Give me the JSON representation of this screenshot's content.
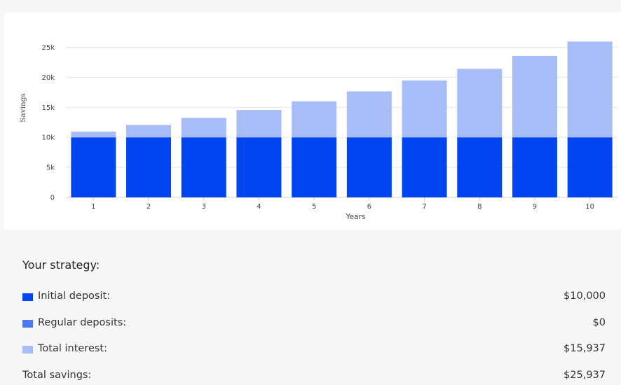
{
  "chart_data": {
    "type": "bar",
    "stacked": true,
    "categories": [
      "1",
      "2",
      "3",
      "4",
      "5",
      "6",
      "7",
      "8",
      "9",
      "10"
    ],
    "series": [
      {
        "name": "Initial deposit",
        "color": "#0045ef",
        "values": [
          10000,
          10000,
          10000,
          10000,
          10000,
          10000,
          10000,
          10000,
          10000,
          10000
        ]
      },
      {
        "name": "Total interest",
        "color": "#a8bcf8",
        "values": [
          950,
          2050,
          3250,
          4550,
          6000,
          7650,
          9450,
          11400,
          13550,
          15937
        ]
      }
    ],
    "xlabel": "Years",
    "ylabel": "Savings",
    "yticks": [
      0,
      5000,
      10000,
      15000,
      20000,
      25000
    ],
    "ytick_labels": [
      "0",
      "5k",
      "10k",
      "15k",
      "20k",
      "25k"
    ],
    "ylim": [
      0,
      27500
    ],
    "grid": true
  },
  "strategy": {
    "title": "Your strategy:",
    "rows": [
      {
        "label": "Initial deposit:",
        "value": "$10,000",
        "color": "#0045ef"
      },
      {
        "label": "Regular deposits:",
        "value": "$0",
        "color": "#4a78ee"
      },
      {
        "label": "Total interest:",
        "value": "$15,937",
        "color": "#a8bcf8"
      }
    ],
    "total": {
      "label": "Total savings:",
      "value": "$25,937"
    }
  }
}
